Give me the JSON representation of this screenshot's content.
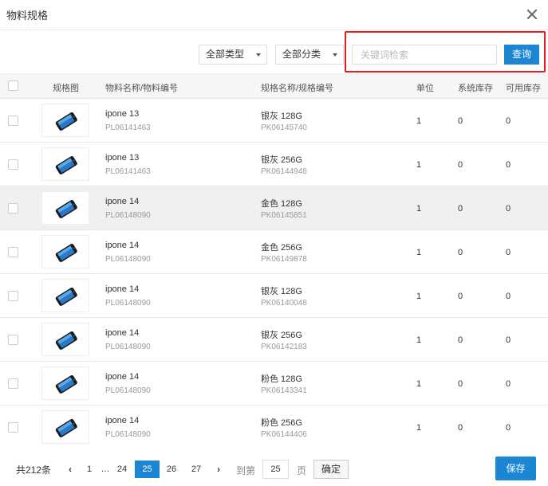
{
  "dialog": {
    "title": "物料规格"
  },
  "toolbar": {
    "type_filter": "全部类型",
    "category_filter": "全部分类",
    "search_placeholder": "关键词检索",
    "query_label": "查询"
  },
  "columns": {
    "image": "规格图",
    "material": "物料名称/物料编号",
    "spec": "规格名称/规格编号",
    "unit": "单位",
    "system_stock": "系统库存",
    "available_stock": "可用库存"
  },
  "rows": [
    {
      "material_name": "ipone 13",
      "material_code": "PL06141463",
      "spec_name": "银灰 128G",
      "spec_code": "PK06145740",
      "unit": "1",
      "system_stock": "0",
      "available_stock": "0",
      "selected": false
    },
    {
      "material_name": "ipone 13",
      "material_code": "PL06141463",
      "spec_name": "银灰 256G",
      "spec_code": "PK06144948",
      "unit": "1",
      "system_stock": "0",
      "available_stock": "0",
      "selected": false
    },
    {
      "material_name": "ipone 14",
      "material_code": "PL06148090",
      "spec_name": "金色 128G",
      "spec_code": "PK06145851",
      "unit": "1",
      "system_stock": "0",
      "available_stock": "0",
      "selected": true
    },
    {
      "material_name": "ipone 14",
      "material_code": "PL06148090",
      "spec_name": "金色 256G",
      "spec_code": "PK06149878",
      "unit": "1",
      "system_stock": "0",
      "available_stock": "0",
      "selected": false
    },
    {
      "material_name": "ipone 14",
      "material_code": "PL06148090",
      "spec_name": "银灰 128G",
      "spec_code": "PK06140048",
      "unit": "1",
      "system_stock": "0",
      "available_stock": "0",
      "selected": false
    },
    {
      "material_name": "ipone 14",
      "material_code": "PL06148090",
      "spec_name": "银灰 256G",
      "spec_code": "PK06142183",
      "unit": "1",
      "system_stock": "0",
      "available_stock": "0",
      "selected": false
    },
    {
      "material_name": "ipone 14",
      "material_code": "PL06148090",
      "spec_name": "粉色 128G",
      "spec_code": "PK06143341",
      "unit": "1",
      "system_stock": "0",
      "available_stock": "0",
      "selected": false
    },
    {
      "material_name": "ipone 14",
      "material_code": "PL06148090",
      "spec_name": "粉色 256G",
      "spec_code": "PK06144406",
      "unit": "1",
      "system_stock": "0",
      "available_stock": "0",
      "selected": false
    }
  ],
  "pagination": {
    "total": "共212条",
    "prev": "‹",
    "first": "1",
    "ellipsis": "…",
    "pages": [
      "24",
      "25",
      "26",
      "27"
    ],
    "current": "25",
    "next": "›",
    "goto_label": "到第",
    "goto_value": "25",
    "page_suffix": "页",
    "confirm_label": "确定"
  },
  "footer": {
    "save_label": "保存"
  },
  "colors": {
    "primary": "#1b87d4",
    "highlight": "#e02020"
  },
  "icons": {
    "close": "close-icon",
    "dropdown": "caret-down-icon",
    "thumbnail": "phone-image"
  }
}
